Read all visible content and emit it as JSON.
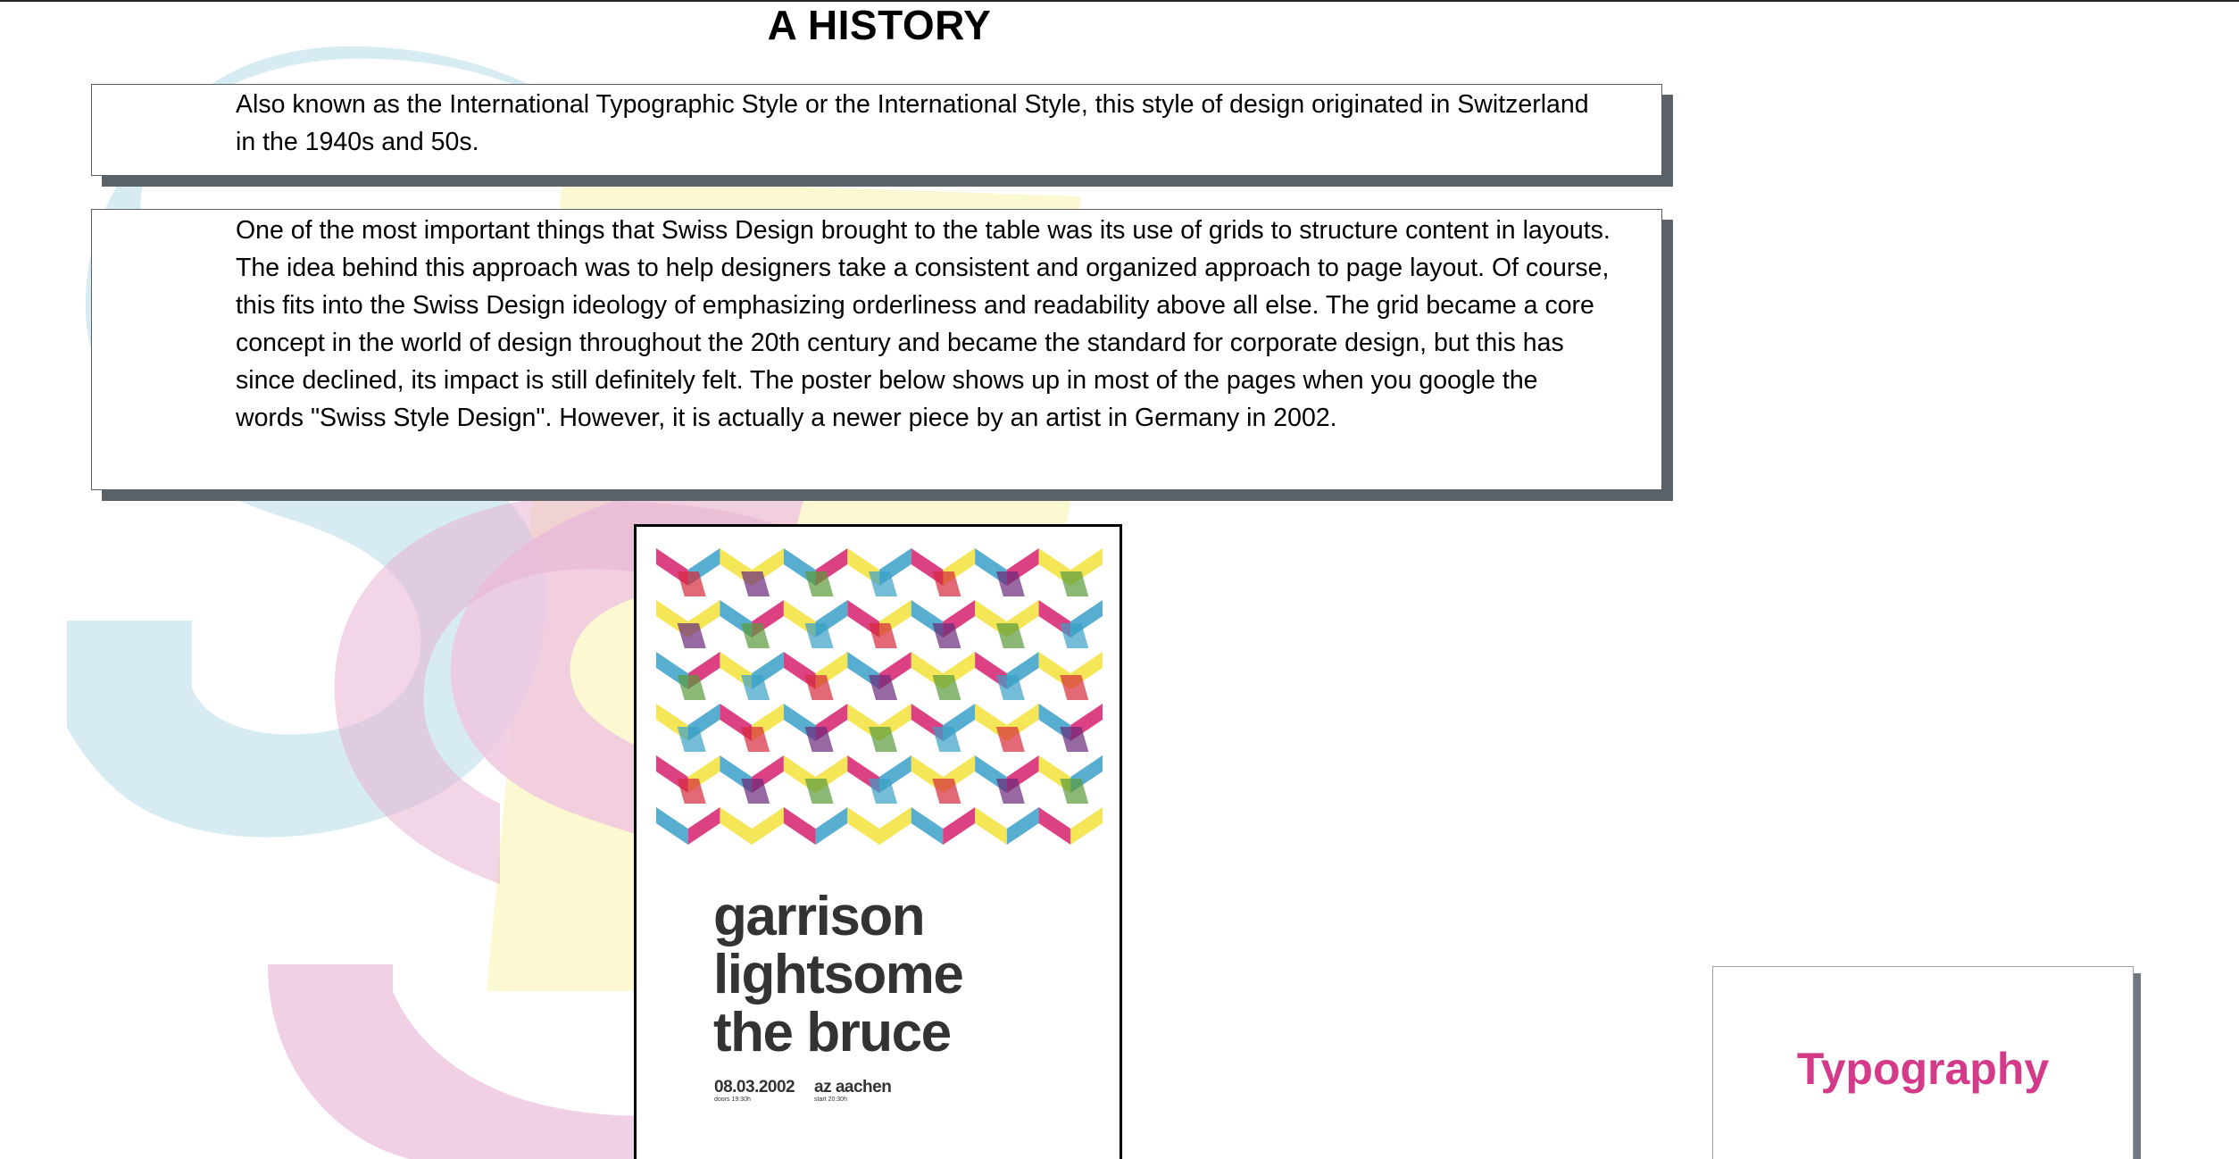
{
  "page": {
    "title": "A HISTORY"
  },
  "intro": {
    "text": "Also known as the International Typographic Style or the International Style, this style of design originated in Switzerland in the 1940s and 50s."
  },
  "history": {
    "text": "One of the most important things that Swiss Design brought to the table was its use of grids to structure content in layouts. The idea behind this approach was to help designers take a consistent and organized approach to page layout. Of course, this fits into the Swiss Design ideology of emphasizing orderliness and readability above all else. The grid became a core concept in the world of design throughout the 20th century and became the standard for corporate design, but this has since declined, its impact is still definitely felt. The poster below shows up in most of the pages when you google the words \"Swiss Style Design\". However, it is actually a newer piece by an artist in Germany in 2002."
  },
  "poster": {
    "name_lines": [
      "garrison",
      "lightsome",
      "the bruce"
    ],
    "date": "08.03.2002",
    "doors": "doors 19:30h",
    "venue": "az aachen",
    "start": "start 20:30h",
    "pattern_colors": {
      "magenta": "#d6206f",
      "yellow": "#f2e23a",
      "cyan": "#3aa0c8",
      "red": "#d62a3a",
      "purple": "#6a2a7a",
      "green": "#5a9a3a"
    }
  },
  "nav": {
    "typography_label": "Typography",
    "label_color": "#d33b8a"
  },
  "background": {
    "letters": [
      "S",
      "S"
    ],
    "colors": {
      "cyan": "#d2e9f1",
      "magenta": "#efc8e0",
      "yellow": "#fcf8cf"
    }
  }
}
